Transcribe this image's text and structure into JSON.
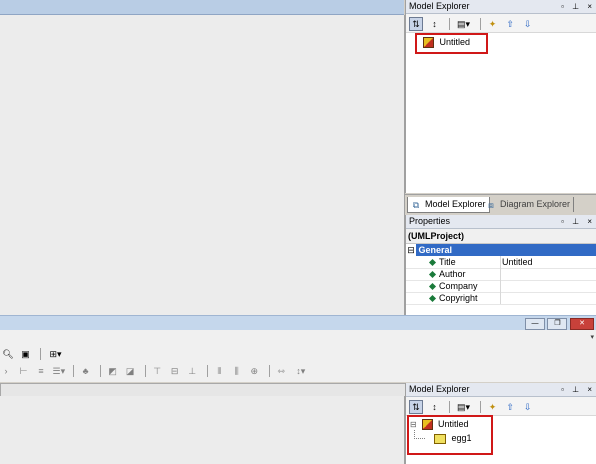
{
  "top_explorer": {
    "title": "Model Explorer",
    "title_buttons": "▫ ⊥ ×",
    "tree_root": "Untitled"
  },
  "tabs": {
    "model_explorer": "Model Explorer",
    "diagram_explorer": "Diagram Explorer"
  },
  "properties": {
    "title": "Properties",
    "title_buttons": "▫ ⊥ ×",
    "object_header": "(UMLProject)",
    "category": "General",
    "category_toggle": "⊟",
    "rows": [
      {
        "name": "Title",
        "value": "Untitled"
      },
      {
        "name": "Author",
        "value": ""
      },
      {
        "name": "Company",
        "value": ""
      },
      {
        "name": "Copyright",
        "value": ""
      }
    ]
  },
  "bottom_window": {
    "window_buttons": {
      "minimize": "—",
      "restore": "❐",
      "close": "✕"
    },
    "overflow_arrow": "▾"
  },
  "bottom_explorer": {
    "title": "Model Explorer",
    "title_buttons": "▫ ⊥ ×",
    "tree_root": "Untitled",
    "tree_child": "egg1",
    "collapse_glyph": "⊟"
  },
  "colors": {
    "titlebar_blue": "#b9cde5",
    "selection_blue": "#316ac5",
    "highlight_red": "#d01818"
  }
}
